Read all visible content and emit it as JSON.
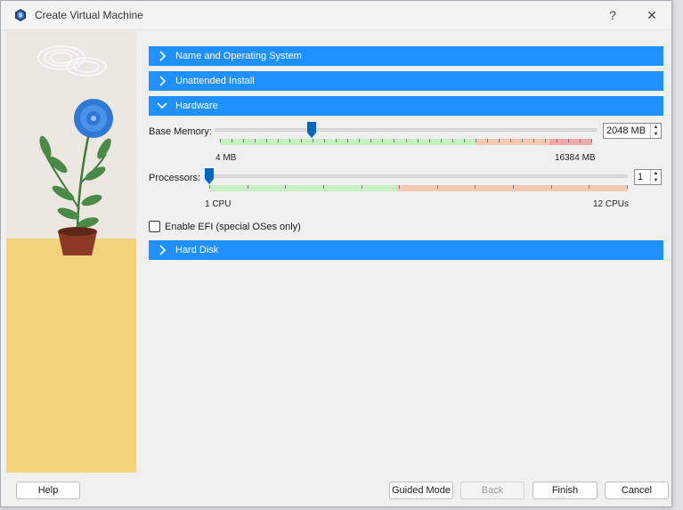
{
  "window": {
    "title": "Create Virtual Machine",
    "help_glyph": "?",
    "close_glyph": "✕"
  },
  "sections": {
    "name_os": {
      "label": "Name and Operating System"
    },
    "unattended": {
      "label": "Unattended Install"
    },
    "hardware": {
      "label": "Hardware"
    },
    "hard_disk": {
      "label": "Hard Disk"
    }
  },
  "hardware": {
    "memory": {
      "label": "Base Memory:",
      "value": "2048 MB",
      "min_label": "4 MB",
      "max_label": "16384 MB",
      "value_fraction": 0.125
    },
    "processors": {
      "label": "Processors:",
      "value": "1",
      "min_label": "1 CPU",
      "max_label": "12 CPUs",
      "value_fraction": 0.0
    },
    "efi": {
      "label": "Enable EFI (special OSes only)",
      "checked": false
    }
  },
  "footer": {
    "help": "Help",
    "guided_mode": "Guided Mode",
    "back": "Back",
    "finish": "Finish",
    "cancel": "Cancel"
  },
  "colors": {
    "section_header": "#1e90ff",
    "slider_green": "#c6efc2",
    "slider_orange": "#f6c9b4",
    "slider_red": "#f2a8a8",
    "thumb": "#0067c0"
  }
}
